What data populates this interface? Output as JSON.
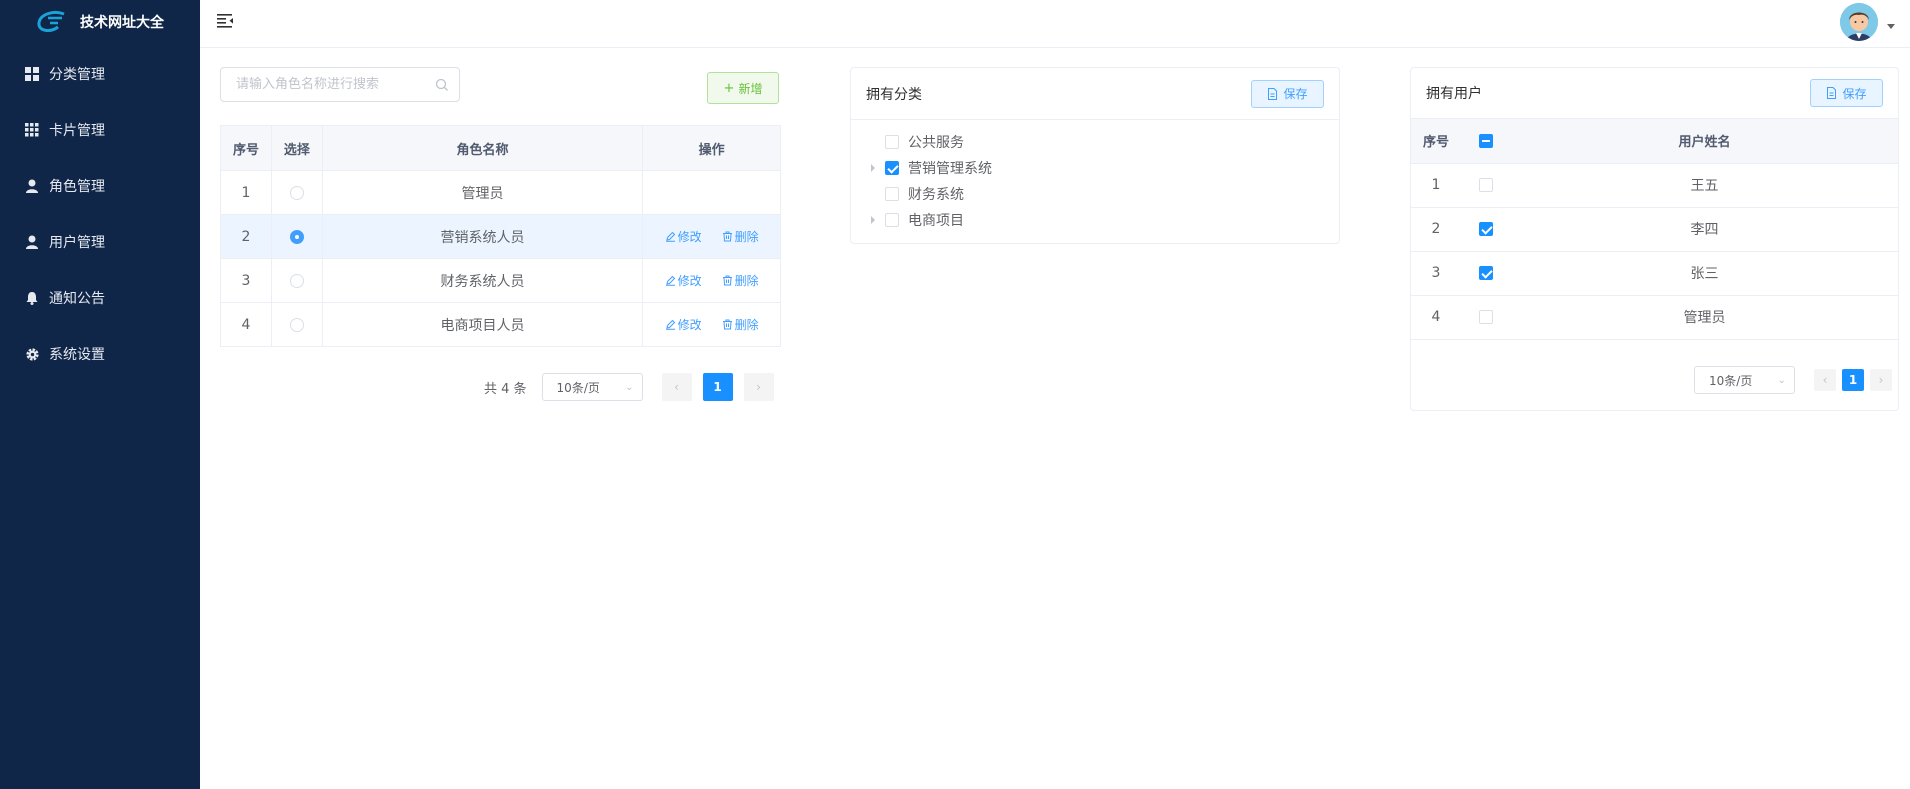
{
  "app": {
    "title": "技术网址大全"
  },
  "sidebar": {
    "items": [
      {
        "label": "分类管理",
        "icon": "grid-icon"
      },
      {
        "label": "卡片管理",
        "icon": "apps-icon"
      },
      {
        "label": "角色管理",
        "icon": "user-icon"
      },
      {
        "label": "用户管理",
        "icon": "user-icon"
      },
      {
        "label": "通知公告",
        "icon": "bell-icon"
      },
      {
        "label": "系统设置",
        "icon": "gear-icon"
      }
    ]
  },
  "roles": {
    "search_placeholder": "请输入角色名称进行搜索",
    "add_label": "新增",
    "columns": [
      "序号",
      "选择",
      "角色名称",
      "操作"
    ],
    "rows": [
      {
        "index": "1",
        "name": "管理员",
        "selected": false,
        "actions": false
      },
      {
        "index": "2",
        "name": "营销系统人员",
        "selected": true,
        "actions": true
      },
      {
        "index": "3",
        "name": "财务系统人员",
        "selected": false,
        "actions": true
      },
      {
        "index": "4",
        "name": "电商项目人员",
        "selected": false,
        "actions": true
      }
    ],
    "edit_label": "修改",
    "delete_label": "删除",
    "pagination": {
      "total": "共 4 条",
      "page_size": "10条/页",
      "current": "1"
    }
  },
  "categories": {
    "title": "拥有分类",
    "save_label": "保存",
    "nodes": [
      {
        "label": "公共服务",
        "checked": false,
        "expandable": false
      },
      {
        "label": "营销管理系统",
        "checked": true,
        "expandable": true
      },
      {
        "label": "财务系统",
        "checked": false,
        "expandable": false
      },
      {
        "label": "电商项目",
        "checked": false,
        "expandable": true
      }
    ]
  },
  "users": {
    "title": "拥有用户",
    "save_label": "保存",
    "columns": [
      "序号",
      "用户姓名"
    ],
    "rows": [
      {
        "index": "1",
        "name": "王五",
        "checked": false
      },
      {
        "index": "2",
        "name": "李四",
        "checked": true
      },
      {
        "index": "3",
        "name": "张三",
        "checked": true
      },
      {
        "index": "4",
        "name": "管理员",
        "checked": false
      }
    ],
    "pagination": {
      "page_size": "10条/页",
      "current": "1"
    }
  },
  "colors": {
    "sidebar_bg": "#0f2649",
    "primary": "#1890ff",
    "success": "#67c23a"
  }
}
